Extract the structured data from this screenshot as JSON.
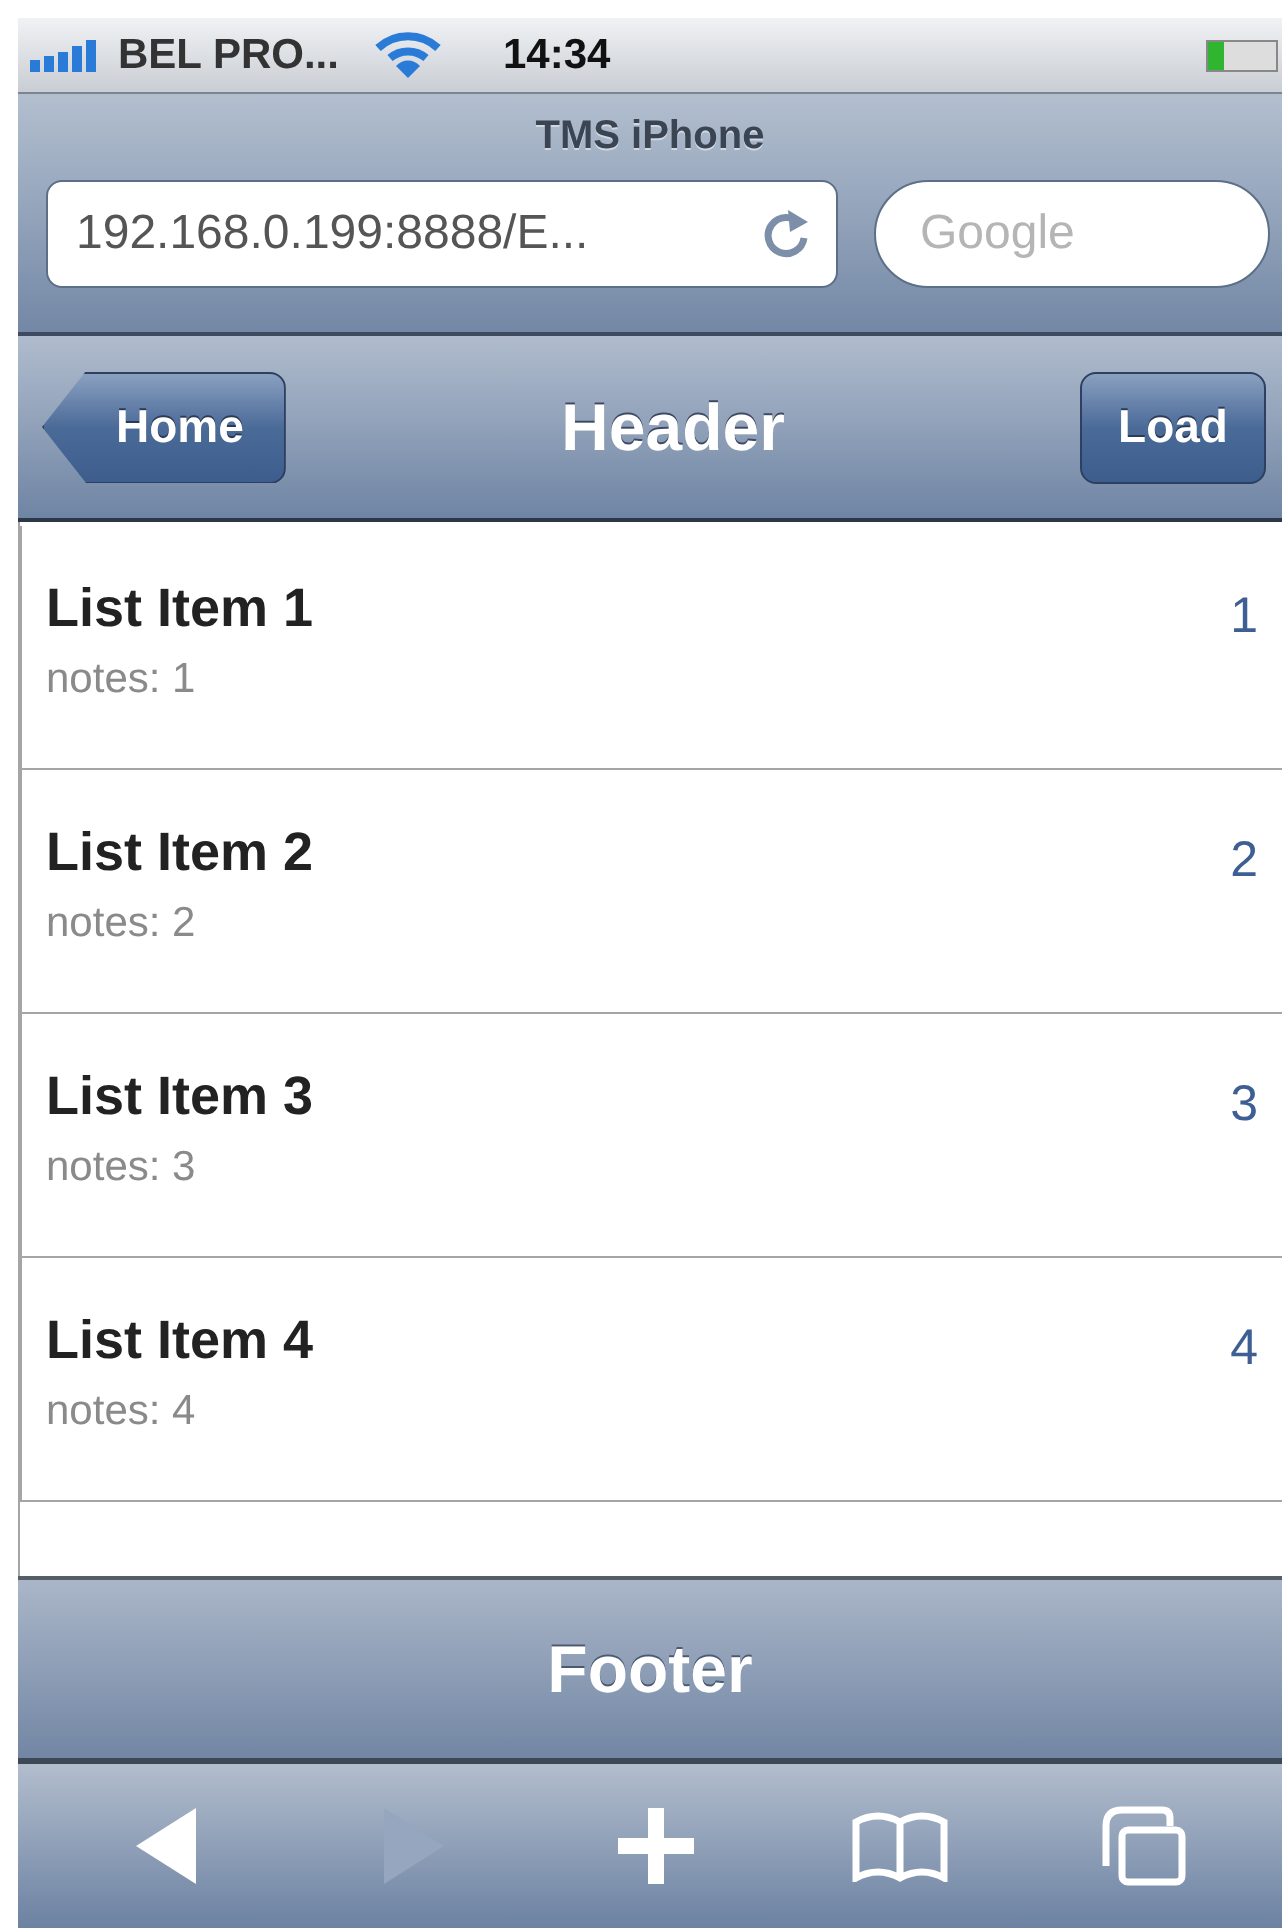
{
  "status_bar": {
    "carrier": "BEL PRO...",
    "time": "14:34"
  },
  "browser": {
    "title": "TMS iPhone",
    "url": "192.168.0.199:8888/E...",
    "search_placeholder": "Google"
  },
  "header": {
    "back_button": "Home",
    "title": "Header",
    "action_button": "Load"
  },
  "list": [
    {
      "title": "List Item 1",
      "notes": "notes: 1",
      "count": "1"
    },
    {
      "title": "List Item 2",
      "notes": "notes: 2",
      "count": "2"
    },
    {
      "title": "List Item 3",
      "notes": "notes: 3",
      "count": "3"
    },
    {
      "title": "List Item 4",
      "notes": "notes: 4",
      "count": "4"
    }
  ],
  "footer": {
    "title": "Footer"
  },
  "toolbar": [
    {
      "kind": "back",
      "disabled": false
    },
    {
      "kind": "forward",
      "disabled": true
    },
    {
      "kind": "add",
      "disabled": false
    },
    {
      "kind": "bookmarks",
      "disabled": false
    },
    {
      "kind": "pages",
      "disabled": false
    }
  ]
}
